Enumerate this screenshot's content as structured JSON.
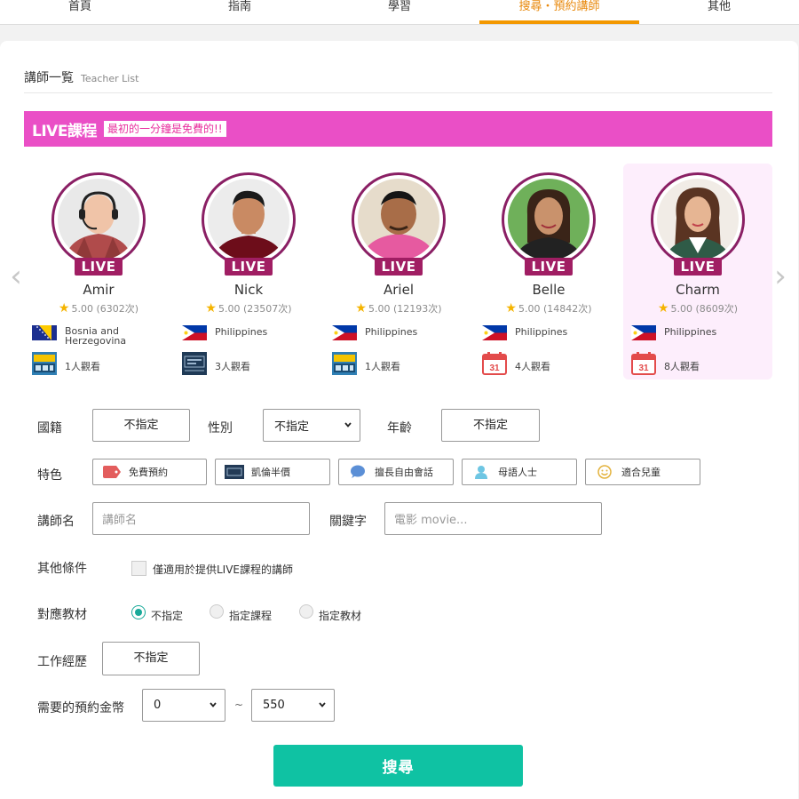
{
  "nav": {
    "items": [
      {
        "label": "首頁"
      },
      {
        "label": "指南"
      },
      {
        "label": "學習"
      },
      {
        "label": "搜尋・預約講師"
      },
      {
        "label": "其他"
      }
    ],
    "active": 3
  },
  "list_header": {
    "title": "講師一覧",
    "subtitle": "Teacher List"
  },
  "live_banner": {
    "title": "LIVE課程",
    "badge": "最初的一分鐘是免費的!!"
  },
  "teachers": [
    {
      "name": "Amir",
      "live_label": "LIVE",
      "rating": "5.00",
      "count": "(6302次)",
      "country": "Bosnia and Herzegovina",
      "viewers": "1人觀看",
      "viewer_icon": "course-thumbnail-icon"
    },
    {
      "name": "Nick",
      "live_label": "LIVE",
      "rating": "5.00",
      "count": "(23507次)",
      "country": "Philippines",
      "viewers": "3人觀看",
      "viewer_icon": "course-thumbnail-icon"
    },
    {
      "name": "Ariel",
      "live_label": "LIVE",
      "rating": "5.00",
      "count": "(12193次)",
      "country": "Philippines",
      "viewers": "1人觀看",
      "viewer_icon": "course-thumbnail-icon"
    },
    {
      "name": "Belle",
      "live_label": "LIVE",
      "rating": "5.00",
      "count": "(14842次)",
      "country": "Philippines",
      "viewers": "4人觀看",
      "viewer_icon": "calendar-icon",
      "calendar_day": "31"
    },
    {
      "name": "Charm",
      "live_label": "LIVE",
      "rating": "5.00",
      "count": "(8609次)",
      "country": "Philippines",
      "viewers": "8人觀看",
      "viewer_icon": "calendar-icon",
      "calendar_day": "31"
    }
  ],
  "filters": {
    "nationality": {
      "label": "國籍",
      "value": "不指定"
    },
    "gender": {
      "label": "性別",
      "value": "不指定"
    },
    "age": {
      "label": "年齡",
      "value": "不指定"
    },
    "features": {
      "label": "特色",
      "items": [
        {
          "label": "免費預約",
          "icon": "tag-icon"
        },
        {
          "label": "凱倫半價",
          "icon": "book-icon"
        },
        {
          "label": "擅長自由會話",
          "icon": "speech-bubble-icon"
        },
        {
          "label": "母語人士",
          "icon": "person-icon"
        },
        {
          "label": "適合兒童",
          "icon": "smiley-icon"
        }
      ]
    },
    "teacher_name": {
      "label": "講師名",
      "placeholder": "講師名"
    },
    "keyword": {
      "label": "關鍵字",
      "placeholder": "電影 movie..."
    },
    "other": {
      "label": "其他條件",
      "checkbox_label": "僅適用於提供LIVE課程的講師"
    },
    "material": {
      "label": "對應教材",
      "options": [
        "不指定",
        "指定課程",
        "指定教材"
      ],
      "selected": 0
    },
    "experience": {
      "label": "工作經歷",
      "value": "不指定"
    },
    "price": {
      "label": "需要的預約金幣",
      "min": "0",
      "separator": "~",
      "max": "550"
    }
  },
  "search_button": "搜尋",
  "colors": {
    "accent": "#f39800",
    "live_banner": "#ea4fc6",
    "live_tag": "#a01e63",
    "search": "#0fc2a3",
    "highlight": "#fdeefc"
  }
}
